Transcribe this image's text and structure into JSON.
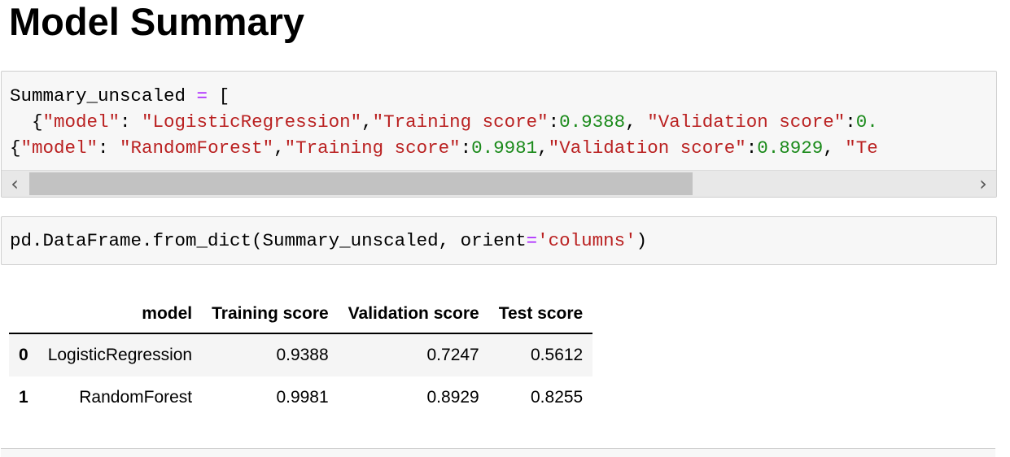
{
  "heading": "Model Summary",
  "cell1": {
    "line1": {
      "name": "Summary_unscaled",
      "op": " = ",
      "bracket": "["
    },
    "line2": {
      "k1": "\"model\"",
      "v1": "\"LogisticRegression\"",
      "k2": "\"Training score\"",
      "v2": "0.9388",
      "k3": "\"Validation score\"",
      "v3": "0."
    },
    "line3": {
      "k1": "\"model\"",
      "v1": "\"RandomForest\"",
      "k2": "\"Training score\"",
      "v2": "0.9981",
      "k3": "\"Validation score\"",
      "v3": "0.8929",
      "k4": "\"Te"
    }
  },
  "cell2": {
    "prefix": "pd.DataFrame.from_dict(Summary_unscaled, orient",
    "eq": "=",
    "arg": "'columns'",
    "suffix": ")"
  },
  "table": {
    "columns": [
      "",
      "model",
      "Training score",
      "Validation score",
      "Test score"
    ],
    "rows": [
      {
        "index": "0",
        "model": "LogisticRegression",
        "training": "0.9388",
        "validation": "0.7247",
        "test": "0.5612"
      },
      {
        "index": "1",
        "model": "RandomForest",
        "training": "0.9981",
        "validation": "0.8929",
        "test": "0.8255"
      }
    ]
  },
  "icons": {
    "scroll_left": "chevron-left-icon",
    "scroll_right": "chevron-right-icon"
  }
}
